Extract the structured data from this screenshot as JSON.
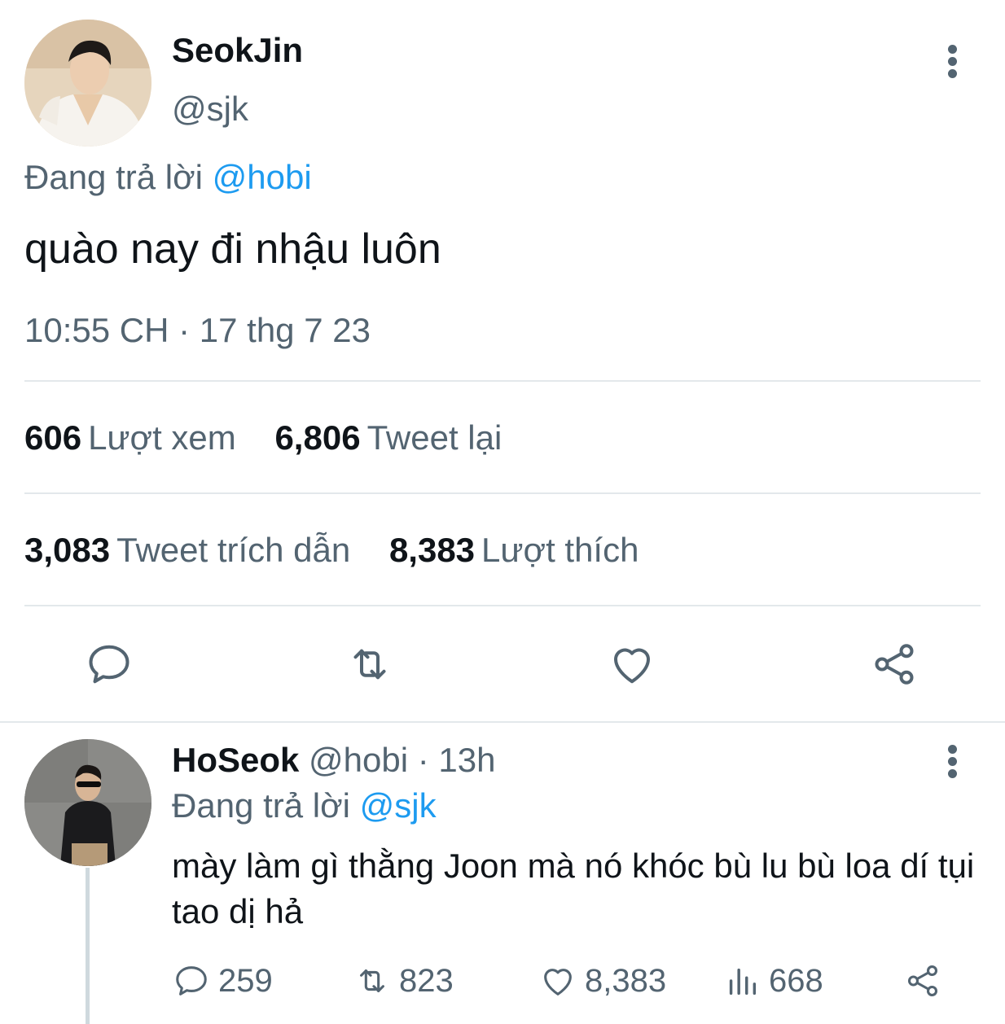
{
  "main_tweet": {
    "author": {
      "display_name": "SeokJin",
      "handle": "@sjk"
    },
    "replying_prefix": "Đang trả lời",
    "replying_to": "@hobi",
    "text": "quào nay đi nhậu luôn",
    "timestamp": "10:55 CH · 17 thg 7 23",
    "stats": {
      "views": {
        "count": "606",
        "label": "Lượt xem"
      },
      "retweets": {
        "count": "6,806",
        "label": "Tweet lại"
      },
      "quotes": {
        "count": "3,083",
        "label": "Tweet trích dẫn"
      },
      "likes": {
        "count": "8,383",
        "label": "Lượt thích"
      }
    },
    "actions": [
      "reply-icon",
      "retweet-icon",
      "like-icon",
      "share-icon"
    ]
  },
  "reply_tweet": {
    "author": {
      "display_name": "HoSeok",
      "handle": "@hobi"
    },
    "age": "· 13h",
    "replying_prefix": "Đang trả lời",
    "replying_to": "@sjk",
    "text": "mày làm gì thằng Joon mà nó khóc bù lu bù loa dí tụi tao dị hả",
    "counts": {
      "replies": "259",
      "retweets": "823",
      "likes": "8,383",
      "views": "668"
    }
  },
  "colors": {
    "text": "#0f1419",
    "secondary": "#536471",
    "link": "#1d9bf0",
    "divider": "#e3e8eb"
  }
}
